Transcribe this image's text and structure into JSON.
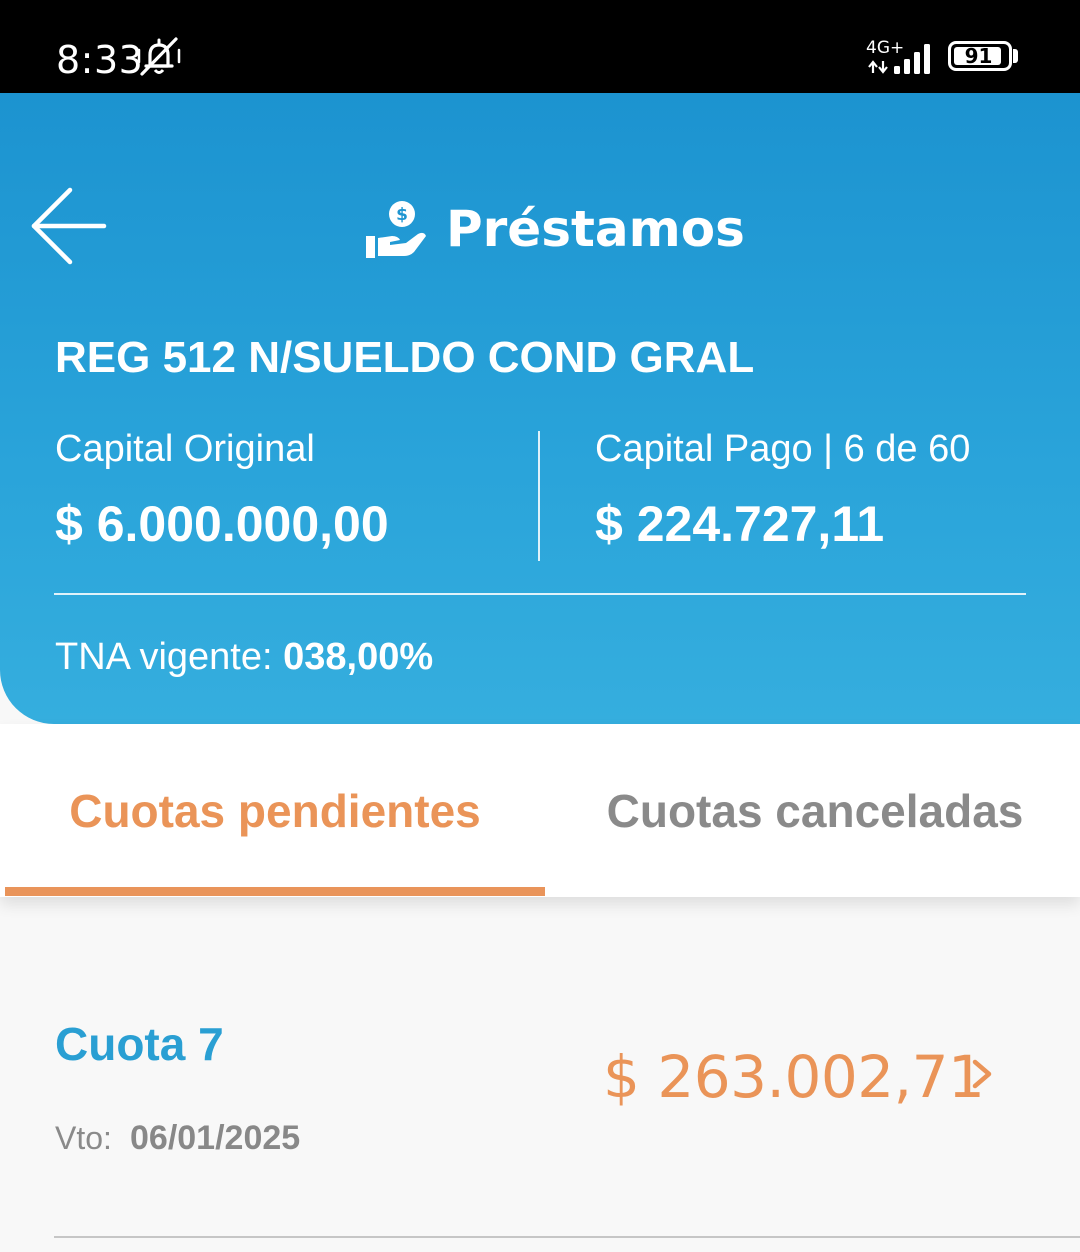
{
  "status_bar": {
    "time": "8:33",
    "network": "4G+",
    "battery": "91",
    "icons": [
      "bell-off-icon",
      "signal-icon",
      "battery-icon"
    ]
  },
  "header": {
    "title": "Préstamos",
    "icons": [
      "back-arrow-icon",
      "hand-money-icon"
    ],
    "loan_name": "REG 512 N/SUELDO COND GRAL",
    "capital_original_label": "Capital Original",
    "capital_original_value": "$ 6.000.000,00",
    "capital_pago_label": "Capital Pago | 6 de 60",
    "capital_pago_value": "$ 224.727,11",
    "tna_label": "TNA vigente:",
    "tna_value": "038,00%"
  },
  "tabs": [
    {
      "label": "Cuotas pendientes",
      "active": true
    },
    {
      "label": "Cuotas canceladas",
      "active": false
    }
  ],
  "cuotas": [
    {
      "title": "Cuota 7",
      "vto_label": "Vto:",
      "vto_date": "06/01/2025",
      "amount": "$ 263.002,71"
    }
  ],
  "colors": {
    "header_blue": "#1c93d0",
    "accent_orange": "#ea9458",
    "cuota_blue": "#2a9fd3",
    "muted_gray": "#8a8a8a"
  }
}
